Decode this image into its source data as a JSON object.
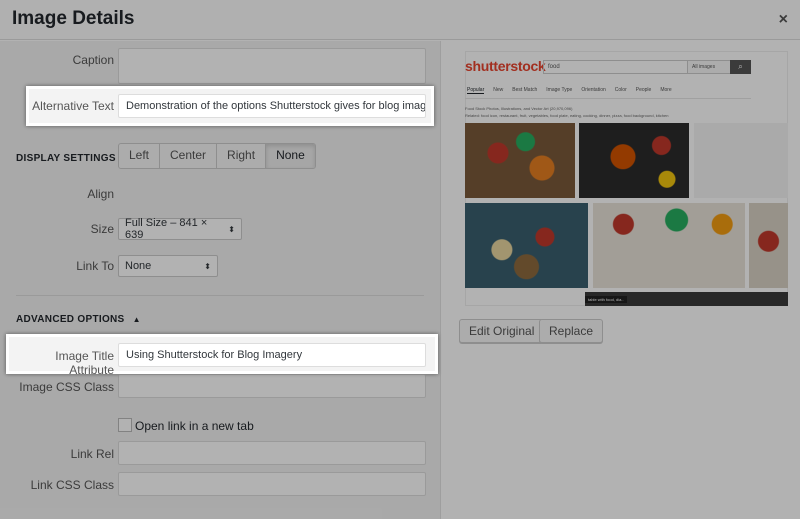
{
  "header": {
    "title": "Image Details",
    "close": "×"
  },
  "fields": {
    "caption_label": "Caption",
    "caption_value": "",
    "alt_label": "Alternative Text",
    "alt_value": "Demonstration of the options Shutterstock gives for blog imager",
    "title_attr_label": "Image Title Attribute",
    "title_attr_value": "Using Shutterstock for Blog Imagery",
    "css_class_label": "Image CSS Class",
    "css_class_value": "",
    "new_tab_label": "Open link in a new tab",
    "link_rel_label": "Link Rel",
    "link_rel_value": "",
    "link_css_label": "Link CSS Class",
    "link_css_value": ""
  },
  "display": {
    "heading": "DISPLAY SETTINGS",
    "align_label": "Align",
    "align_options": [
      "Left",
      "Center",
      "Right",
      "None"
    ],
    "align_selected": "None",
    "size_label": "Size",
    "size_value": "Full Size – 841 × 639",
    "linkto_label": "Link To",
    "linkto_value": "None"
  },
  "advanced": {
    "heading": "ADVANCED OPTIONS",
    "arrow": "▲"
  },
  "preview": {
    "logo": "shutterstock",
    "search_value": "food",
    "dropdown": "All images",
    "tabs": [
      "Popular",
      "New",
      "Best Match",
      "Image Type",
      "Orientation",
      "Color",
      "People",
      "More"
    ],
    "meta_line1": "Food Stock Photos, Illustrations, and Vector Art (20,970,096)",
    "meta_line2": "Related: food icon, restaurant, fruit, vegetables, food plate, eating, cooking, dinner, pizza, food background, kitchen",
    "caption": "table with food, dia.."
  },
  "buttons": {
    "edit": "Edit Original",
    "replace": "Replace"
  },
  "colors": {
    "brand": "#e8442e",
    "overlay": "rgba(0,0,0,0.3)"
  }
}
